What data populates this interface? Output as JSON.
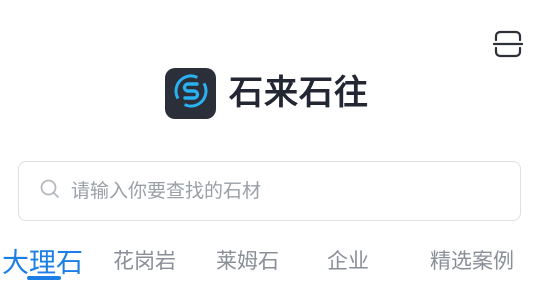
{
  "header": {
    "app_name": "石来石往",
    "scan_icon": "scan-icon",
    "logo_icon": "stone-logo-icon"
  },
  "search": {
    "placeholder": "请输入你要查找的石材",
    "value": "",
    "icon": "search-icon"
  },
  "tabs": [
    {
      "label": "大理石",
      "active": true
    },
    {
      "label": "花岗岩",
      "active": false
    },
    {
      "label": "莱姆石",
      "active": false
    },
    {
      "label": "企业",
      "active": false
    },
    {
      "label": "精选案例",
      "active": false
    }
  ],
  "colors": {
    "accent": "#1c7fe6",
    "logo_bg": "#2b2f3a",
    "logo_ring": "#2ab1f0",
    "tab_inactive": "#8a8f97"
  }
}
